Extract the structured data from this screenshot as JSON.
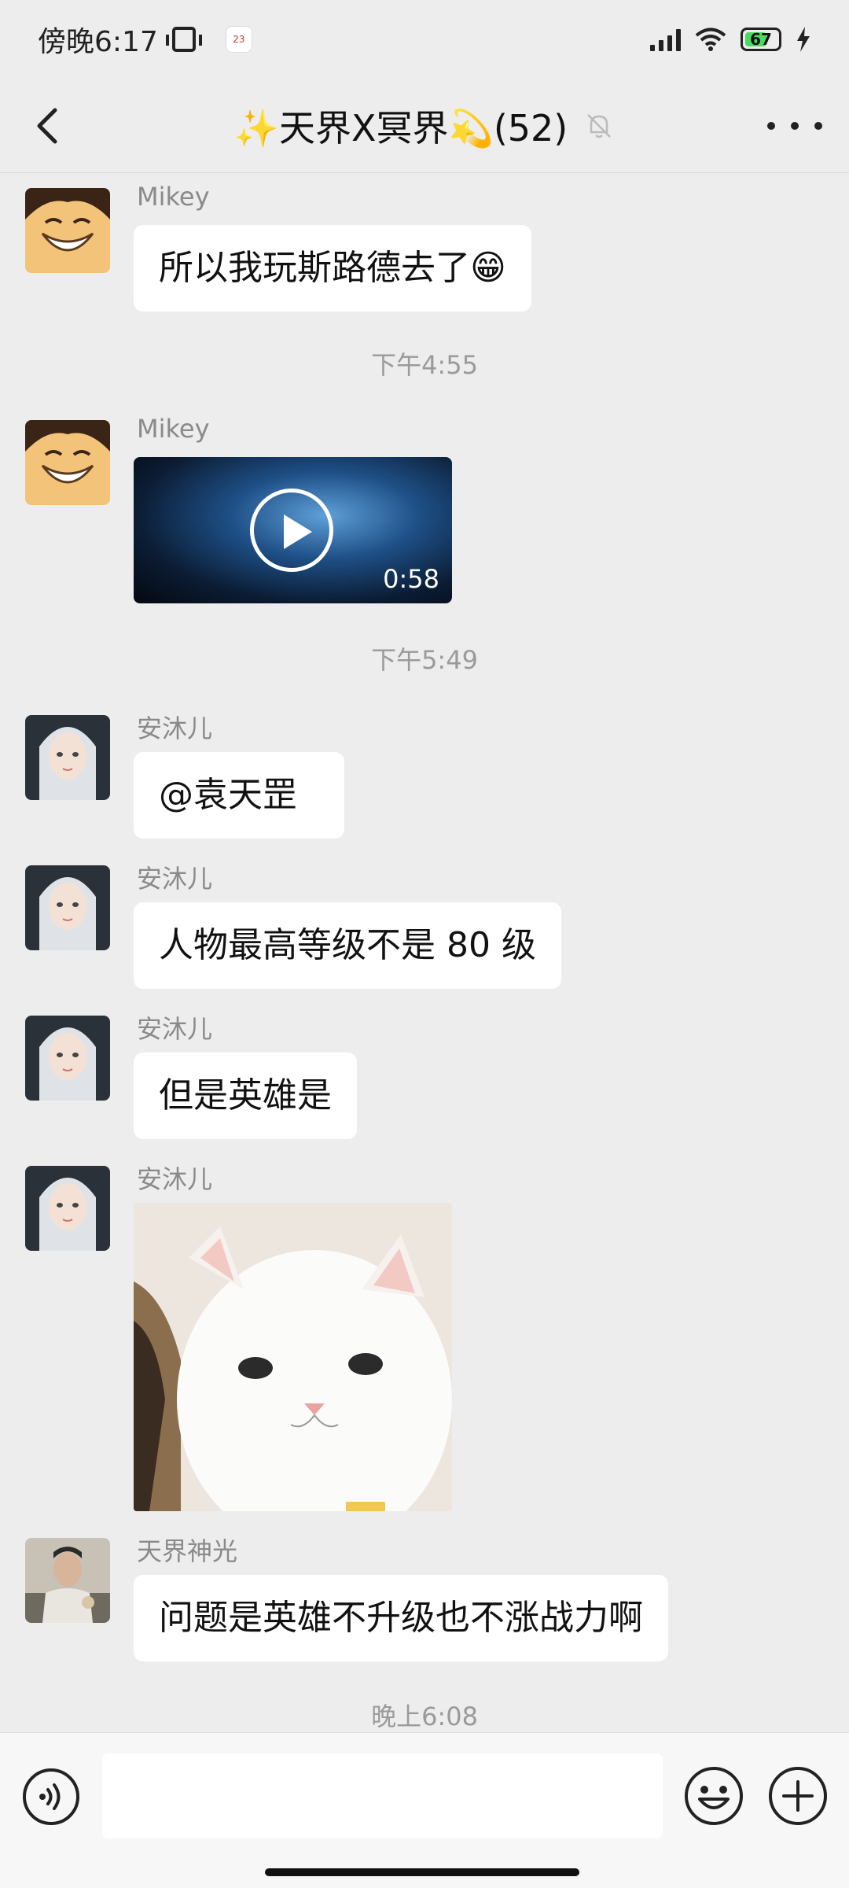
{
  "status_bar": {
    "time": "傍晚6:17",
    "calendar_day": "23",
    "battery": "67",
    "battery_level": 0.67
  },
  "header": {
    "title": "✨天界X冥界💫(52)"
  },
  "messages": [
    {
      "sender": "Mikey",
      "text": "所以我玩斯路德去了😁"
    },
    {
      "timestamp": "下午4:55"
    },
    {
      "sender": "Mikey",
      "video_duration": "0:58"
    },
    {
      "timestamp": "下午5:49"
    },
    {
      "sender": "安沐儿",
      "text": "@袁天罡"
    },
    {
      "sender": "安沐儿",
      "text": "人物最高等级不是 80 级"
    },
    {
      "sender": "安沐儿",
      "text": "但是英雄是"
    },
    {
      "sender": "安沐儿",
      "image": "white-cat-sticker"
    },
    {
      "sender": "天界神光",
      "text": "问题是英雄不升级也不涨战力啊"
    },
    {
      "timestamp": "晚上6:08"
    }
  ],
  "input": {
    "placeholder": ""
  },
  "icons": {
    "back": "chevron-left-icon",
    "mute": "bell-muted-icon",
    "more": "more-dots-icon",
    "voice": "voice-icon",
    "emoji": "emoji-icon",
    "plus": "plus-icon"
  }
}
